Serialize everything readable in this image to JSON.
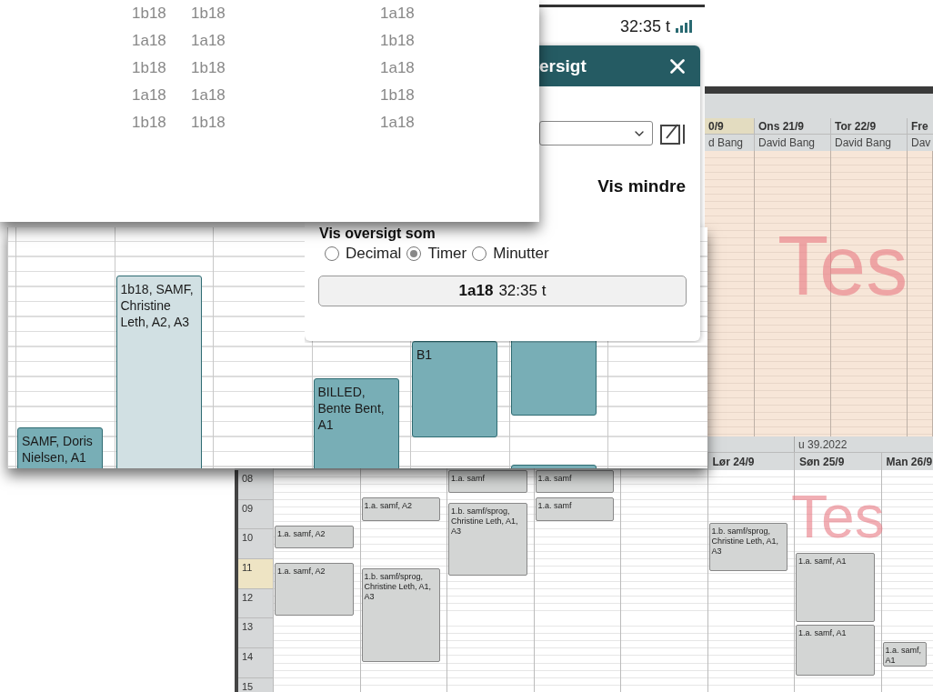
{
  "class_list": {
    "columns": [
      [
        "1b18",
        "1a18",
        "1b18",
        "1a18",
        "1b18"
      ],
      [
        "1b18",
        "1a18",
        "1b18",
        "1a18",
        "1b18"
      ],
      [
        "1a18",
        "1b18",
        "1a18",
        "1b18",
        "1a18"
      ]
    ]
  },
  "app_header": {
    "total": "32:35 t"
  },
  "overview_dialog": {
    "title": "ersigt",
    "toggle": "Vis mindre",
    "format_label": "Vis oversigt som",
    "formats": [
      {
        "label": "Decimal",
        "selected": false
      },
      {
        "label": "Timer",
        "selected": true
      },
      {
        "label": "Minutter",
        "selected": false
      }
    ],
    "summary": {
      "class": "1a18",
      "time": "32:35 t"
    }
  },
  "team_calendar": {
    "events": [
      {
        "text": "SAMF, Doris Nielsen, A1",
        "kind": "teal"
      },
      {
        "text": "1b18, SAMF, Christine Leth, A2, A3",
        "kind": "pale"
      },
      {
        "text": "BILLED, Bente Bent, A1",
        "kind": "teal"
      },
      {
        "text": "B1",
        "kind": "teal"
      },
      {
        "kind": "teal"
      },
      {
        "kind": "teal"
      }
    ]
  },
  "week_calendar": {
    "week": "u 39.2022",
    "days": [
      {
        "label": "Lør 24/9"
      },
      {
        "label": "Søn 25/9"
      },
      {
        "label": "Man 26/9"
      }
    ],
    "hours": [
      {
        "label": "08",
        "selected": false
      },
      {
        "label": "09",
        "selected": false
      },
      {
        "label": "10",
        "selected": false
      },
      {
        "label": "11",
        "selected": true
      },
      {
        "label": "12",
        "selected": false
      },
      {
        "label": "13",
        "selected": false
      },
      {
        "label": "14",
        "selected": false
      },
      {
        "label": "15",
        "selected": false
      }
    ],
    "events": [
      {
        "text": "1.a. samf, A2"
      },
      {
        "text": "1.a. samf, A2"
      },
      {
        "text": "1.a. samf, A2"
      },
      {
        "text": "1.b. samf/sprog, Christine Leth, A1, A3"
      },
      {
        "text": "1.a. samf"
      },
      {
        "text": "1.b. samf/sprog, Christine Leth, A1, A3"
      },
      {
        "text": "1.a. samf"
      },
      {
        "text": "1.a. samf"
      },
      {
        "text": "1.b. samf/sprog, Christine Leth, A1, A3"
      },
      {
        "text": "1.a. samf, A1"
      },
      {
        "text": "1.a. samf, A1"
      },
      {
        "text": "1.a. samf, A1"
      }
    ],
    "watermark": "Tes"
  },
  "back_calendar": {
    "days": [
      {
        "label": "0/9",
        "teacher": "d Bang",
        "selected": true
      },
      {
        "label": "Ons 21/9",
        "teacher": "David Bang",
        "selected": false
      },
      {
        "label": "Tor 22/9",
        "teacher": "David Bang",
        "selected": false
      },
      {
        "label": "Fre",
        "teacher": "Dav",
        "selected": false
      }
    ],
    "watermark": "Tes"
  }
}
